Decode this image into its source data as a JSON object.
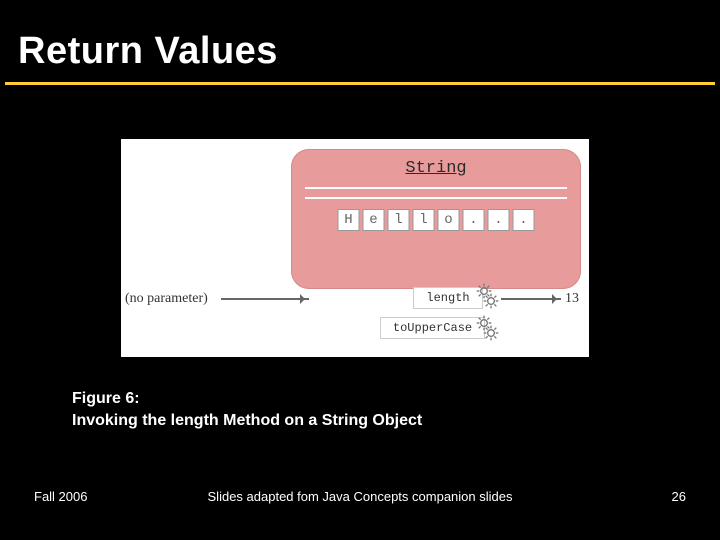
{
  "title": "Return Values",
  "figure": {
    "class_label": "String",
    "cells": [
      "H",
      "e",
      "l",
      "l",
      "o",
      ".",
      ".",
      "."
    ],
    "no_param": "(no parameter)",
    "method1": "length",
    "method2": "toUpperCase",
    "result": "13"
  },
  "caption_line1": "Figure 6:",
  "caption_line2": "Invoking the length Method on a String Object",
  "footer": {
    "left": "Fall 2006",
    "mid": "Slides adapted fom Java Concepts companion slides",
    "right": "26"
  }
}
